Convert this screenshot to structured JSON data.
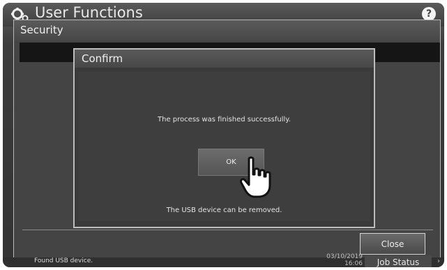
{
  "header": {
    "title": "User Functions",
    "help_label": "?"
  },
  "security_panel": {
    "title": "Security",
    "close_label": "Close"
  },
  "confirm_dialog": {
    "title": "Confirm",
    "message": "The process was finished successfully.",
    "ok_label": "OK",
    "usb_message": "The USB device can be removed."
  },
  "status_bar": {
    "message": "Found USB device.",
    "date": "03/10/2019",
    "time": "16:06",
    "job_status_label": "Job Status",
    "chevron": "›"
  },
  "colors": {
    "background": "#3c3c3c",
    "dialog_border": "#bdbdbd",
    "text": "#e4e4e4"
  }
}
